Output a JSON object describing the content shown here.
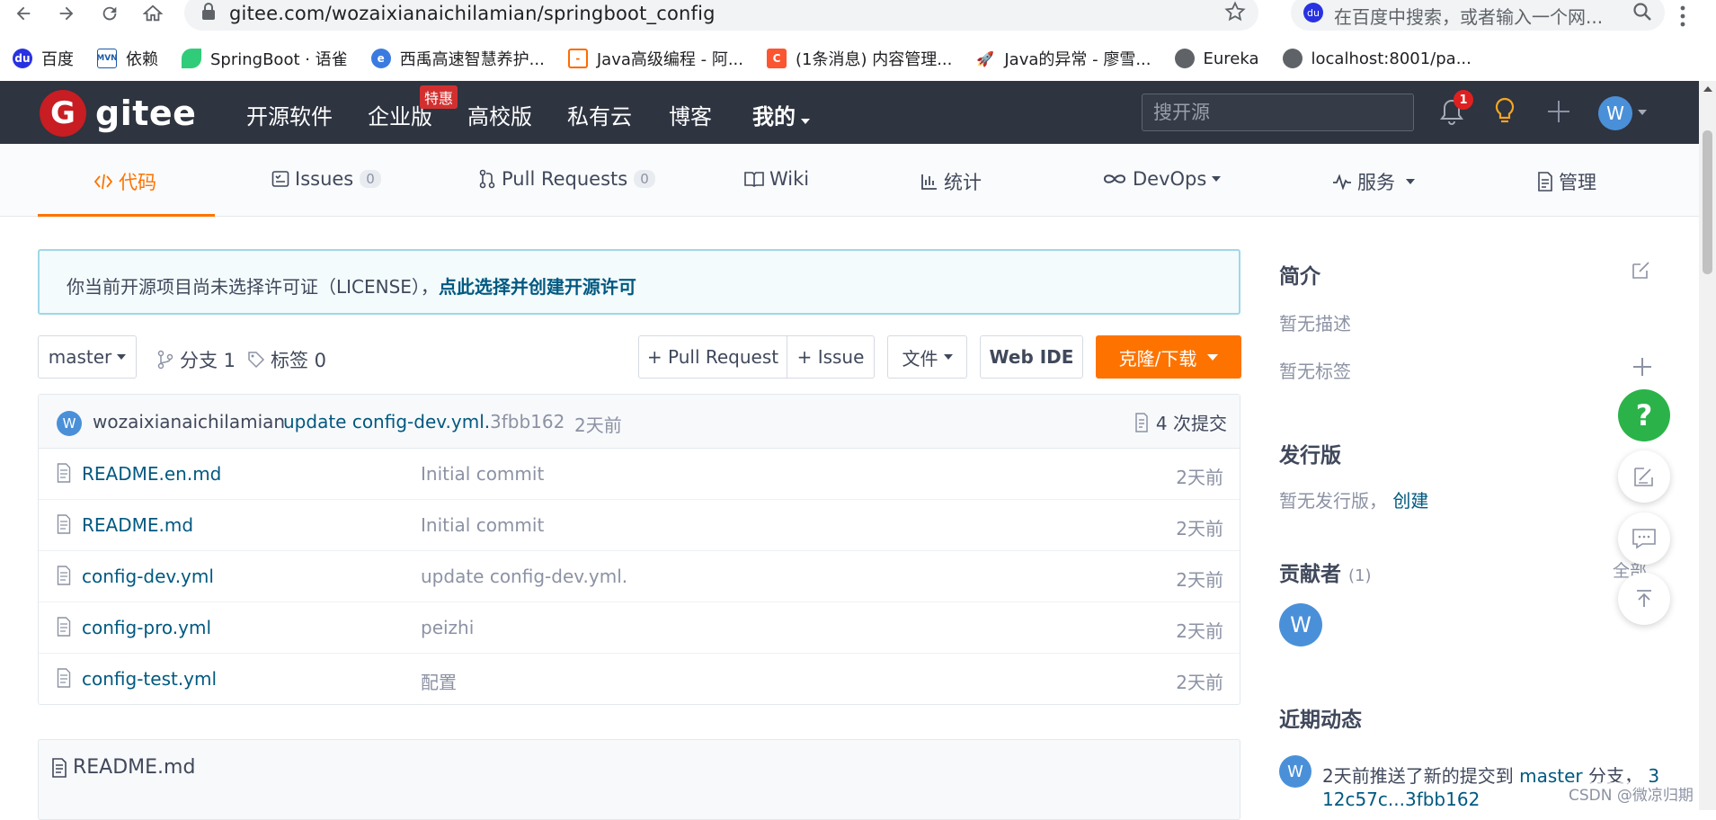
{
  "browser": {
    "url": "gitee.com/wozaixianaichilamian/springboot_config",
    "search_placeholder": "在百度中搜索，或者输入一个网...",
    "bookmarks": [
      "百度",
      "依赖",
      "SpringBoot · 语雀",
      "西禹高速智慧养护...",
      "Java高级编程 - 阿...",
      "(1条消息) 内容管理...",
      "Java的异常 - 廖雪...",
      "Eureka",
      "localhost:8001/pa..."
    ]
  },
  "gitee": {
    "logo_text": "gitee",
    "nav": [
      "开源软件",
      "企业版",
      "高校版",
      "私有云",
      "博客",
      "我的"
    ],
    "promo_badge": "特惠",
    "search_placeholder": "搜开源",
    "notification_count": "1",
    "user_initial": "W"
  },
  "tabs": {
    "code": "代码",
    "issues": "Issues",
    "issues_count": "0",
    "pulls": "Pull Requests",
    "pulls_count": "0",
    "wiki": "Wiki",
    "stats": "统计",
    "devops": "DevOps",
    "service": "服务",
    "manage": "管理"
  },
  "notice": {
    "text": "你当前开源项目尚未选择许可证（LICENSE），",
    "link": "点此选择并创建开源许可"
  },
  "toolbar": {
    "branch": "master",
    "branches": "分支 1",
    "tags": "标签 0",
    "pull_request": "+ Pull Request",
    "issue": "+ Issue",
    "file": "文件",
    "webide": "Web IDE",
    "clone": "克隆/下载"
  },
  "commit": {
    "author_initial": "W",
    "author": "wozaixianaichilamian",
    "message": "update config-dev.yml.",
    "hash": "3fbb162",
    "time": "2天前",
    "count": "4 次提交"
  },
  "files": [
    {
      "name": "README.en.md",
      "message": "Initial commit",
      "time": "2天前"
    },
    {
      "name": "README.md",
      "message": "Initial commit",
      "time": "2天前"
    },
    {
      "name": "config-dev.yml",
      "message": "update config-dev.yml.",
      "time": "2天前"
    },
    {
      "name": "config-pro.yml",
      "message": "peizhi",
      "time": "2天前"
    },
    {
      "name": "config-test.yml",
      "message": "配置",
      "time": "2天前"
    }
  ],
  "readme": {
    "title": "README.md"
  },
  "sidebar": {
    "intro_title": "简介",
    "no_desc": "暂无描述",
    "no_tags": "暂无标签",
    "release_title": "发行版",
    "no_release": "暂无发行版，",
    "create": "创建",
    "contributors_title": "贡献者",
    "contributors_count": "(1)",
    "all": "全部",
    "contributor_initial": "W",
    "activity_title": "近期动态",
    "activity_initial": "W",
    "activity_text": "2天前推送了新的提交到",
    "activity_branch": "master",
    "activity_suffix": "分支，",
    "activity_commits": "3",
    "activity_line2": "12c57c...3fbb162"
  },
  "watermark": "CSDN @微凉归期",
  "colors": {
    "accent": "#fe7300",
    "nav_bg": "#2e3440",
    "link": "#005980",
    "brand": "#c71d23"
  }
}
